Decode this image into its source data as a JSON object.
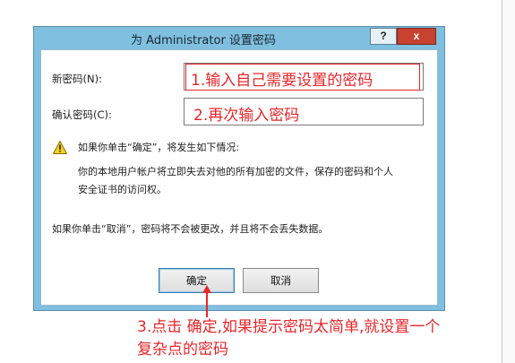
{
  "window": {
    "title": "为 Administrator 设置密码",
    "help_label": "?",
    "close_label": "x"
  },
  "form": {
    "new_password_label": "新密码(N):",
    "confirm_password_label": "确认密码(C):",
    "new_password_value": "",
    "confirm_password_value": ""
  },
  "warning": {
    "heading": "如果你单击“确定”，将发生如下情况:",
    "detail_line1": "你的本地用户帐户将立即失去对他的所有加密的文件，保存的密码和个人",
    "detail_line2": "安全证书的访问权。",
    "cancel_note": "如果你单击“取消”，密码将不会被更改，并且将不会丢失数据。"
  },
  "buttons": {
    "ok_label": "确定",
    "cancel_label": "取消"
  },
  "annotations": {
    "step1": "1.输入自己需要设置的密码",
    "step2": "2.再次输入密码",
    "step3_line1": "3.点击 确定,如果提示密码太简单,就设置一个",
    "step3_line2": "复杂点的密码",
    "color": "#e8262a"
  },
  "icons": {
    "warning": "warning-icon"
  }
}
